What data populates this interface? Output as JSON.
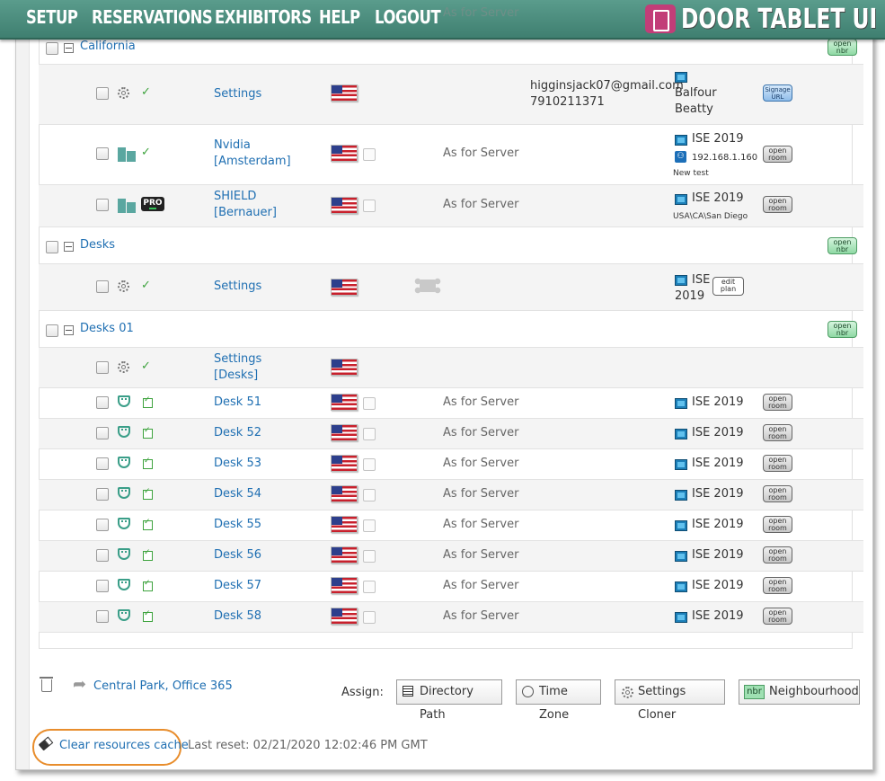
{
  "nav": {
    "items": [
      "SETUP",
      "RESERVATIONS",
      "EXHIBITORS",
      "HELP",
      "LOGOUT"
    ],
    "ghost_text": "As for Server",
    "brand": "DOOR TABLET UI"
  },
  "groups": [
    {
      "title": "California",
      "button": "open\nnbr"
    },
    {
      "title": "Desks",
      "button": "open\nnbr"
    },
    {
      "title": "Desks 01",
      "button": "open\nnbr"
    }
  ],
  "california": {
    "settings": {
      "label": "Settings",
      "email": "higginsjack07@gmail.com",
      "phone": "7910211371",
      "exhibitor": "Balfour\nBeatty",
      "button": "Signage\nURL"
    },
    "nvidia": {
      "label": "Nvidia\n[Amsterdam]",
      "timezone": "As for Server",
      "exhibitor": "ISE 2019",
      "ip": "192.168.1.160",
      "note": "New test",
      "button": "open\nroom"
    },
    "shield": {
      "label": "SHIELD\n[Bernauer]",
      "badge": "PRO",
      "timezone": "As for Server",
      "exhibitor": "ISE 2019",
      "location": "USA\\CA\\San Diego",
      "button": "open\nroom"
    }
  },
  "desks": {
    "settings": {
      "label": "Settings",
      "exhibitor": "ISE\n2019",
      "button": "edit\nplan"
    }
  },
  "desks01": {
    "settings": {
      "label": "Settings\n[Desks]"
    },
    "items": [
      {
        "label": "Desk 51",
        "timezone": "As for Server",
        "exhibitor": "ISE 2019",
        "button": "open\nroom"
      },
      {
        "label": "Desk 52",
        "timezone": "As for Server",
        "exhibitor": "ISE 2019",
        "button": "open\nroom"
      },
      {
        "label": "Desk 53",
        "timezone": "As for Server",
        "exhibitor": "ISE 2019",
        "button": "open\nroom"
      },
      {
        "label": "Desk 54",
        "timezone": "As for Server",
        "exhibitor": "ISE 2019",
        "button": "open\nroom"
      },
      {
        "label": "Desk 55",
        "timezone": "As for Server",
        "exhibitor": "ISE 2019",
        "button": "open\nroom"
      },
      {
        "label": "Desk 56",
        "timezone": "As for Server",
        "exhibitor": "ISE 2019",
        "button": "open\nroom"
      },
      {
        "label": "Desk 57",
        "timezone": "As for Server",
        "exhibitor": "ISE 2019",
        "button": "open\nroom"
      },
      {
        "label": "Desk 58",
        "timezone": "As for Server",
        "exhibitor": "ISE 2019",
        "button": "open\nroom"
      }
    ]
  },
  "footer": {
    "share_link": "Central Park, Office 365",
    "assign_label": "Assign:",
    "directory_path": "Directory Path",
    "time_zone": "Time Zone",
    "settings_cloner": "Settings Cloner",
    "nbr_badge": "nbr",
    "neighbourhood": "Neighbourhood",
    "clear_cache": "Clear resources cache",
    "last_reset": "Last reset: 02/21/2020 12:02:46 PM GMT"
  },
  "colors": {
    "nav_bg": "#4a8c7c",
    "link": "#1f6fb2",
    "highlight": "#e88d2c"
  }
}
